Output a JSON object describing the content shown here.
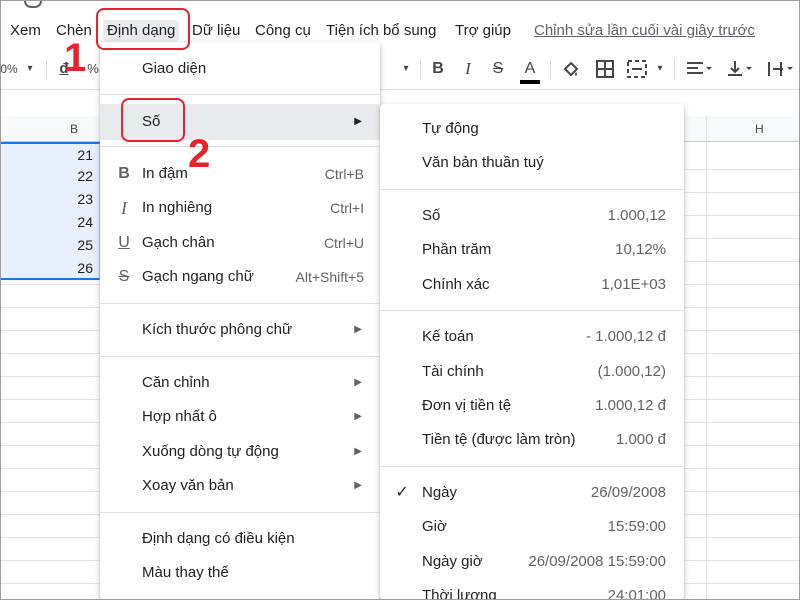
{
  "colors": {
    "annotation": "#e8212f",
    "hover": "#e8eaed",
    "selection_fill": "#e8f0fe",
    "selection_border": "#1a73e8",
    "text_primary": "#202124",
    "text_secondary": "#5f6368"
  },
  "menubar": {
    "items": [
      "Xem",
      "Chèn",
      "Định dạng",
      "Dữ liệu",
      "Công cụ",
      "Tiện ích bổ sung",
      "Trợ giúp"
    ],
    "active_item": "Định dạng",
    "last_edit": "Chỉnh sửa lần cuối vài giây trước"
  },
  "toolbar": {
    "zoom_partial": "0%",
    "currency_partial": "đ",
    "percent_partial": "%",
    "icons": [
      "chevron-down-icon",
      "bold-icon",
      "italic-icon",
      "strikethrough-icon",
      "text-color-icon",
      "fill-color-icon",
      "borders-icon",
      "merge-cells-icon",
      "horizontal-align-icon",
      "vertical-align-icon",
      "text-wrap-icon"
    ]
  },
  "grid": {
    "column_b": "B",
    "column_h": "H",
    "cells_b": [
      "21",
      "22",
      "23",
      "24",
      "25",
      "26"
    ]
  },
  "format_menu": {
    "items": [
      {
        "label": "Giao diện",
        "shortcut": "",
        "icon": "",
        "submenu": false
      },
      {
        "label": "Số",
        "shortcut": "",
        "icon": "",
        "submenu": true,
        "hover": true
      },
      {
        "label": "In đậm",
        "shortcut": "Ctrl+B",
        "icon": "bold-icon",
        "icon_glyph": "B",
        "submenu": false
      },
      {
        "label": "In nghiêng",
        "shortcut": "Ctrl+I",
        "icon": "italic-icon",
        "icon_glyph": "I",
        "submenu": false
      },
      {
        "label": "Gạch chân",
        "shortcut": "Ctrl+U",
        "icon": "underline-icon",
        "icon_glyph": "U",
        "submenu": false
      },
      {
        "label": "Gạch ngang chữ",
        "shortcut": "Alt+Shift+5",
        "icon": "strikethrough-icon",
        "icon_glyph": "S",
        "submenu": false
      },
      {
        "label": "Kích thước phông chữ",
        "shortcut": "",
        "icon": "",
        "submenu": true
      },
      {
        "label": "Căn chỉnh",
        "shortcut": "",
        "icon": "",
        "submenu": true
      },
      {
        "label": "Hợp nhất ô",
        "shortcut": "",
        "icon": "",
        "submenu": true
      },
      {
        "label": "Xuống dòng tự động",
        "shortcut": "",
        "icon": "",
        "submenu": true
      },
      {
        "label": "Xoay văn bản",
        "shortcut": "",
        "icon": "",
        "submenu": true
      },
      {
        "label": "Định dạng có điều kiện",
        "shortcut": "",
        "icon": "",
        "submenu": false
      },
      {
        "label": "Màu thay thế",
        "shortcut": "",
        "icon": "",
        "submenu": false
      }
    ]
  },
  "number_menu": {
    "items": [
      {
        "label": "Tự động",
        "example": "",
        "checked": false
      },
      {
        "label": "Văn bản thuần tuý",
        "example": "",
        "checked": false
      },
      {
        "label": "Số",
        "example": "1.000,12",
        "checked": false
      },
      {
        "label": "Phần trăm",
        "example": "10,12%",
        "checked": false
      },
      {
        "label": "Chính xác",
        "example": "1,01E+03",
        "checked": false
      },
      {
        "label": "Kế toán",
        "example": "- 1.000,12 đ",
        "checked": false
      },
      {
        "label": "Tài chính",
        "example": "(1.000,12)",
        "checked": false
      },
      {
        "label": "Đơn vị tiền tệ",
        "example": "1.000,12 đ",
        "checked": false
      },
      {
        "label": "Tiền tệ (được làm tròn)",
        "example": "1.000 đ",
        "checked": false
      },
      {
        "label": "Ngày",
        "example": "26/09/2008",
        "checked": true
      },
      {
        "label": "Giờ",
        "example": "15:59:00",
        "checked": false
      },
      {
        "label": "Ngày giờ",
        "example": "26/09/2008 15:59:00",
        "checked": false
      },
      {
        "label": "Thời lượng",
        "example": "24:01:00",
        "checked": false
      }
    ]
  },
  "annotations": {
    "step1": "1",
    "step2": "2"
  }
}
